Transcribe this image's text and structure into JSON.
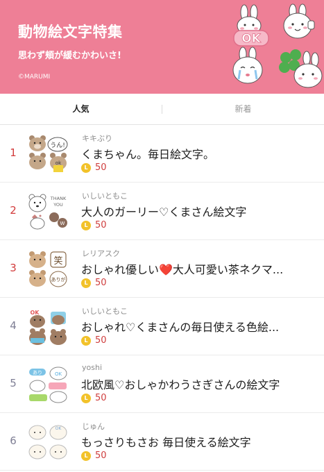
{
  "banner": {
    "title": "動物絵文字特集",
    "subtitle": "思わず頬が緩むかわいさ!",
    "copyright": "©MARUMI",
    "background": "#ee7f96",
    "art_text": "OK"
  },
  "tabs": [
    {
      "label": "人気",
      "active": true
    },
    {
      "label": "新着",
      "active": false
    }
  ],
  "items": [
    {
      "rank": "1",
      "author": "キキぶり",
      "title": "くまちゃん。毎日絵文字。",
      "price": "50",
      "thumb_text": [
        "うん!",
        "ok"
      ]
    },
    {
      "rank": "2",
      "author": "いしいともこ",
      "title": "大人のガーリー♡くまさん絵文字",
      "price": "50",
      "thumb_text": [
        "THANK",
        "YOU",
        "W"
      ]
    },
    {
      "rank": "3",
      "author": "レリアスク",
      "title": "おしゃれ優しい❤️大人可愛い茶ネクマ...",
      "price": "50",
      "thumb_text": [
        "笑",
        "ありが"
      ]
    },
    {
      "rank": "4",
      "author": "いしいともこ",
      "title": "おしゃれ♡くまさんの毎日使える色絵...",
      "price": "50",
      "thumb_text": [
        "OK"
      ]
    },
    {
      "rank": "5",
      "author": "yoshi",
      "title": "北欧風♡おしゃかわうさぎさんの絵文字",
      "price": "50",
      "thumb_text": [
        "あり",
        "OK"
      ]
    },
    {
      "rank": "6",
      "author": "じゅん",
      "title": "もっさりもさお 毎日使える絵文字",
      "price": "50",
      "thumb_text": [
        "OK"
      ]
    }
  ],
  "coin_symbol": "L",
  "colors": {
    "rank_top": "#d23a3a",
    "rank_plain": "#7e7e94",
    "price": "#cf3d3d",
    "coin": "#f2c22a"
  }
}
